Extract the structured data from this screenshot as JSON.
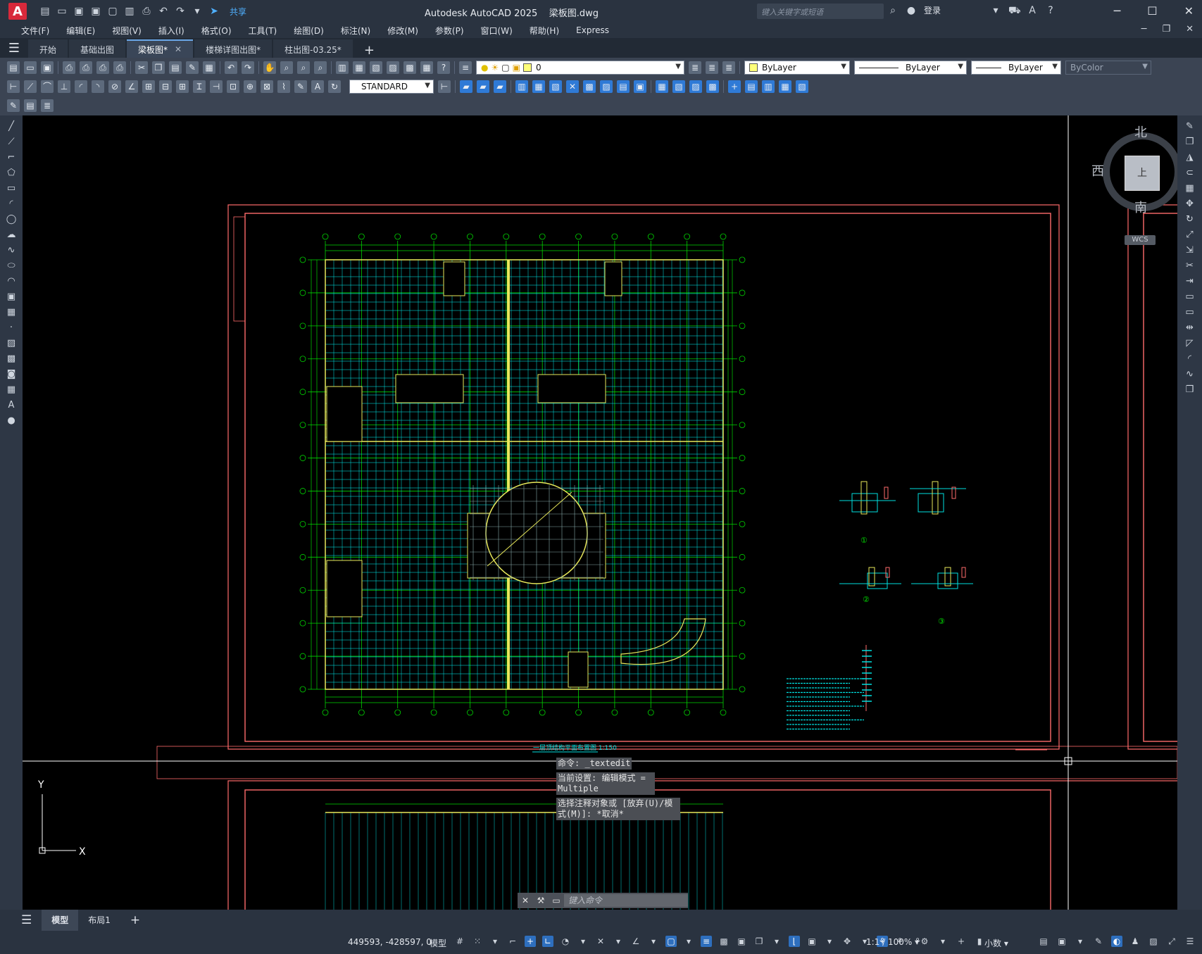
{
  "title": {
    "app": "Autodesk AutoCAD 2025",
    "file": "梁板图.dwg",
    "logo": "A"
  },
  "quick_access": {
    "share": "共享"
  },
  "search": {
    "placeholder": "键入关键字或短语"
  },
  "account": {
    "login": "登录"
  },
  "menu": [
    "文件(F)",
    "编辑(E)",
    "视图(V)",
    "插入(I)",
    "格式(O)",
    "工具(T)",
    "绘图(D)",
    "标注(N)",
    "修改(M)",
    "参数(P)",
    "窗口(W)",
    "帮助(H)",
    "Express"
  ],
  "doc_tabs": [
    {
      "label": "开始",
      "active": false,
      "closable": false
    },
    {
      "label": "基础出图",
      "active": false,
      "closable": false
    },
    {
      "label": "梁板图*",
      "active": true,
      "closable": true
    },
    {
      "label": "楼梯详图出图*",
      "active": false,
      "closable": false
    },
    {
      "label": "柱出图-03.25*",
      "active": false,
      "closable": false
    }
  ],
  "layer": {
    "current": "0",
    "swatch_color": "#ffff7a"
  },
  "properties": {
    "color": "ByLayer",
    "linetype": "ByLayer",
    "lineweight": "ByLayer",
    "plotstyle": "ByColor"
  },
  "dimstyle": {
    "current": "STANDARD"
  },
  "viewcube": {
    "north": "北",
    "south": "南",
    "east": "东",
    "west": "西",
    "top": "上",
    "wcs": "WCS"
  },
  "ucs": {
    "x": "X",
    "y": "Y"
  },
  "command": {
    "history": [
      "命令: _textedit",
      "当前设置: 编辑模式 = Multiple",
      "选择注释对象或 [放弃(U)/模式(M)]: *取消*"
    ],
    "placeholder": "键入命令"
  },
  "drawing": {
    "plan_title": "一层顶结构平面布置图 1:150",
    "detail_labels": [
      "①",
      "①",
      "②",
      "③"
    ],
    "colors": {
      "frame": "#ff6b6b",
      "grid": "#00e0e0",
      "axis": "#00d400",
      "beam": "#e8e85a",
      "bg": "#000000"
    }
  },
  "layout_tabs": [
    {
      "label": "模型",
      "active": true
    },
    {
      "label": "布局1",
      "active": false
    }
  ],
  "status": {
    "coords": "449593, -428597, 0",
    "space": "模型",
    "scale": "1:1 / 100%",
    "units": "小数"
  }
}
